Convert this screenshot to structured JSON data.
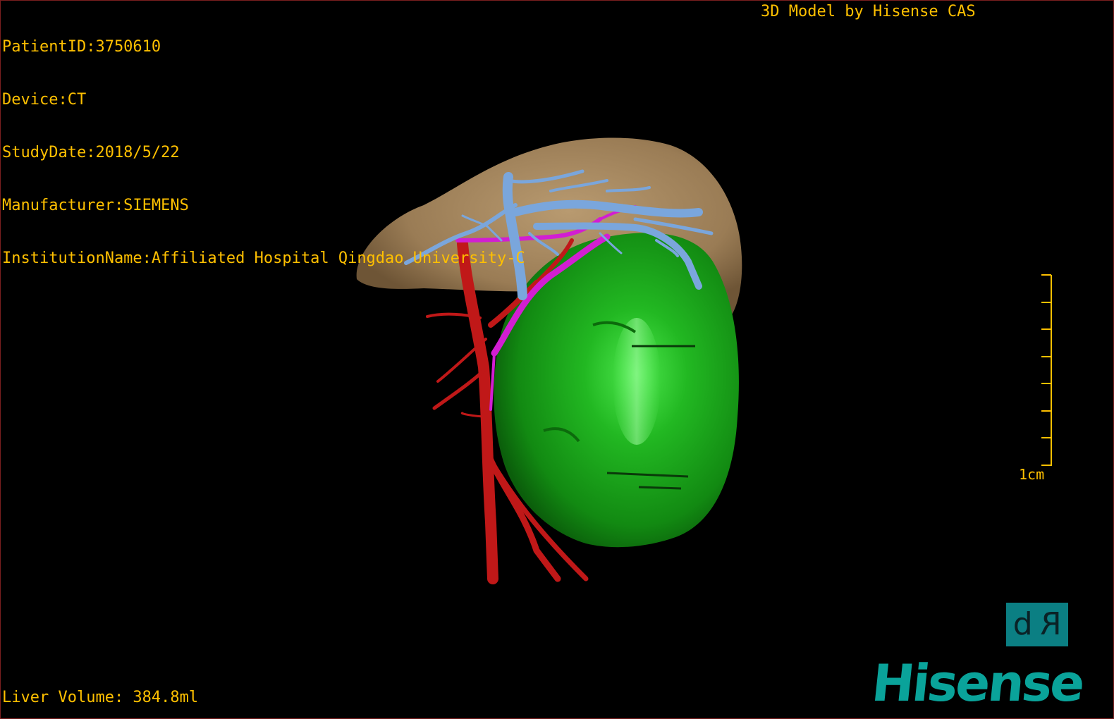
{
  "header": {
    "patient_id": "PatientID:3750610",
    "device": "Device:CT",
    "study_date": "StudyDate:2018/5/22",
    "manufacturer": "Manufacturer:SIEMENS",
    "institution": "InstitutionName:Affiliated Hospital Qingdao University-C",
    "model_credit": "3D Model by Hisense CAS"
  },
  "footer": {
    "liver_volume": "Liver Volume: 384.8ml"
  },
  "scale": {
    "label": "1cm",
    "ticks": 8
  },
  "badge": {
    "left": "d",
    "right": "R"
  },
  "brand": {
    "name": "Hisense"
  },
  "colors": {
    "overlay_text": "#ffc000",
    "liver": "#a88b64",
    "tumor": "#1fa81f",
    "portal_vein": "#7aa6dc",
    "artery": "#c01818",
    "bile_duct": "#d21ed2",
    "brand": "#0aa39a",
    "badge_bg": "#0b7f83"
  },
  "icons": {
    "badge_icon": "dr-view-orientation-icon"
  }
}
